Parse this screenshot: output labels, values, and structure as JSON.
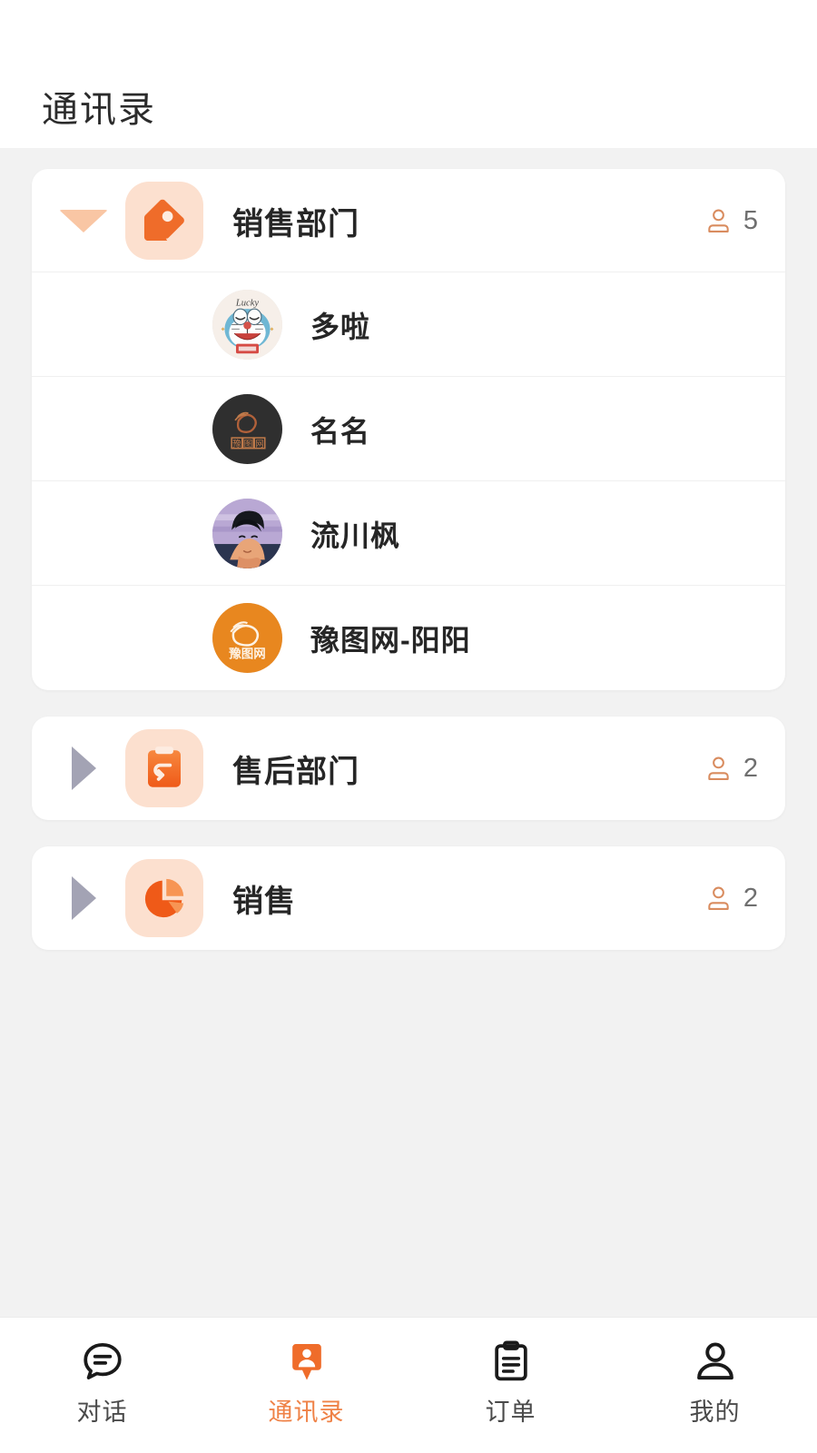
{
  "header": {
    "title": "通讯录"
  },
  "theme": {
    "accent": "#ef6c2a",
    "accent_light": "#fce0cf",
    "arrow_expanded": "#f9c6a4",
    "arrow_collapsed": "#a3a3b4",
    "page_bg": "#f2f2f2",
    "card_bg": "#ffffff",
    "text_primary": "#262626",
    "text_muted": "#6f6f6f",
    "count_icon": "#d98c5f"
  },
  "departments": [
    {
      "name": "销售部门",
      "icon": "tag-icon",
      "member_count": "5",
      "expanded": true,
      "members": [
        {
          "name": "多啦",
          "avatar": "doraemon-lucky-avatar"
        },
        {
          "name": "名名",
          "avatar": "yutuwang-dark-avatar"
        },
        {
          "name": "流川枫",
          "avatar": "anime-boy-avatar"
        },
        {
          "name": "豫图网-阳阳",
          "avatar": "yutuwang-orange-avatar"
        }
      ]
    },
    {
      "name": "售后部门",
      "icon": "clipboard-return-icon",
      "member_count": "2",
      "expanded": false,
      "members": []
    },
    {
      "name": "销售",
      "icon": "pie-chart-icon",
      "member_count": "2",
      "expanded": false,
      "members": []
    }
  ],
  "tabbar": {
    "tabs": [
      {
        "label": "对话",
        "icon": "chat-bubble-icon",
        "active": false
      },
      {
        "label": "通讯录",
        "icon": "contacts-badge-icon",
        "active": true
      },
      {
        "label": "订单",
        "icon": "clipboard-icon",
        "active": false
      },
      {
        "label": "我的",
        "icon": "person-icon",
        "active": false
      }
    ]
  }
}
